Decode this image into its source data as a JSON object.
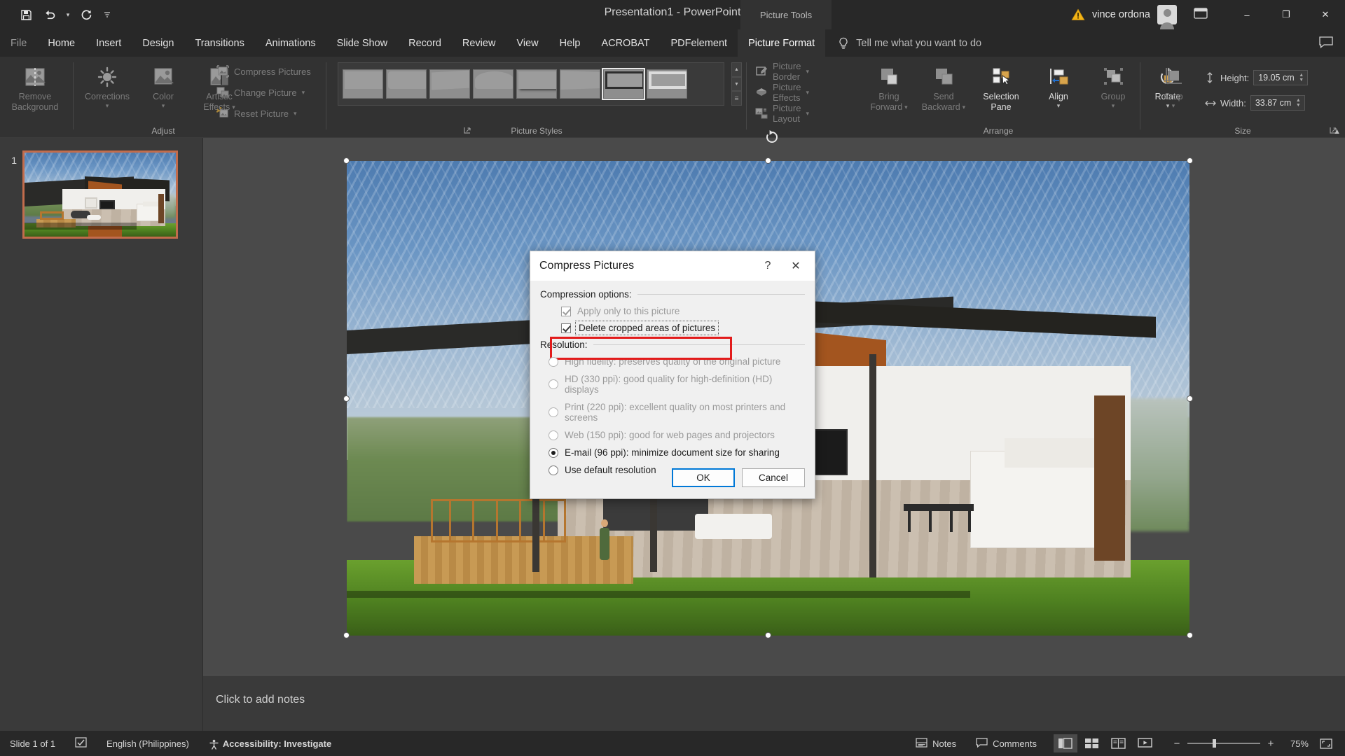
{
  "window": {
    "title": "Presentation1  -  PowerPoint",
    "contextual_tab_group": "Picture Tools",
    "account_name": "vince ordona",
    "icons": {
      "save": "save-icon",
      "undo": "undo-icon",
      "redo": "redo-icon",
      "qat_more": "qat-more-icon",
      "warning": "warning-icon",
      "avatar": "avatar-icon",
      "ribbon_display_options": "ribbon-display-options-icon",
      "minimize": "minimize-icon",
      "restore": "restore-icon",
      "close": "close-icon"
    },
    "controls": {
      "minimize": "–",
      "restore": "❐",
      "close": "✕"
    }
  },
  "tabs": [
    {
      "label": "File",
      "state": "dim"
    },
    {
      "label": "Home",
      "state": "normal"
    },
    {
      "label": "Insert",
      "state": "normal"
    },
    {
      "label": "Design",
      "state": "normal"
    },
    {
      "label": "Transitions",
      "state": "normal"
    },
    {
      "label": "Animations",
      "state": "normal"
    },
    {
      "label": "Slide Show",
      "state": "normal"
    },
    {
      "label": "Record",
      "state": "normal"
    },
    {
      "label": "Review",
      "state": "normal"
    },
    {
      "label": "View",
      "state": "normal"
    },
    {
      "label": "Help",
      "state": "normal"
    },
    {
      "label": "ACROBAT",
      "state": "normal"
    },
    {
      "label": "PDFelement",
      "state": "normal"
    },
    {
      "label": "Picture Format",
      "state": "active"
    }
  ],
  "tellme": {
    "placeholder": "Tell me what you want to do",
    "icon": "lightbulb-icon"
  },
  "ribbon": {
    "groups": [
      {
        "name": "Adjust",
        "label": "Adjust"
      },
      {
        "name": "PictureStyles",
        "label": "Picture Styles"
      },
      {
        "name": "Arrange",
        "label": "Arrange"
      },
      {
        "name": "Size",
        "label": "Size"
      }
    ],
    "adjust": {
      "remove_background": "Remove\nBackground",
      "remove_background_l1": "Remove",
      "remove_background_l2": "Background",
      "corrections": "Corrections",
      "color": "Color",
      "artistic_effects_l1": "Artistic",
      "artistic_effects_l2": "Effects",
      "compress_pictures": "Compress Pictures",
      "change_picture": "Change Picture",
      "reset_picture": "Reset Picture"
    },
    "picture_styles": {
      "picture_border": "Picture Border",
      "picture_effects": "Picture Effects",
      "picture_layout": "Picture Layout",
      "gallery_count": 8,
      "selected_index": 6
    },
    "arrange": {
      "bring_forward_l1": "Bring",
      "bring_forward_l2": "Forward",
      "send_backward_l1": "Send",
      "send_backward_l2": "Backward",
      "selection_pane_l1": "Selection",
      "selection_pane_l2": "Pane",
      "align": "Align",
      "group": "Group",
      "rotate": "Rotate"
    },
    "size": {
      "crop": "Crop",
      "height_label": "Height:",
      "height_value": "19.05 cm",
      "width_label": "Width:",
      "width_value": "33.87 cm"
    }
  },
  "slides": {
    "thumbnails": [
      {
        "number": "1"
      }
    ]
  },
  "notes": {
    "placeholder": "Click to add notes"
  },
  "dialog": {
    "title": "Compress Pictures",
    "help": "?",
    "close": "✕",
    "compression_section": "Compression options:",
    "checkboxes": [
      {
        "label": "Apply only to this picture",
        "accel": "A",
        "checked": true,
        "disabled": true,
        "highlighted": false
      },
      {
        "label": "Delete cropped areas of pictures",
        "accel": "D",
        "checked": true,
        "disabled": false,
        "highlighted": true
      }
    ],
    "resolution_section": "Resolution:",
    "resolutions": [
      {
        "label": "High fidelity: preserves quality of the original picture",
        "selected": false,
        "disabled": true
      },
      {
        "label": "HD (330 ppi): good quality for high-definition (HD) displays",
        "selected": false,
        "disabled": true
      },
      {
        "label": "Print (220 ppi): excellent quality on most printers and screens",
        "selected": false,
        "disabled": true
      },
      {
        "label": "Web (150 ppi): good for web pages and projectors",
        "selected": false,
        "disabled": true
      },
      {
        "label": "E-mail (96 ppi): minimize document size for sharing",
        "selected": true,
        "disabled": false
      },
      {
        "label": "Use default resolution",
        "selected": false,
        "disabled": false
      }
    ],
    "ok_label": "OK",
    "cancel_label": "Cancel",
    "highlight_color": "#e21b1b"
  },
  "statusbar": {
    "slide_indicator": "Slide 1 of 1",
    "language": "English (Philippines)",
    "accessibility": "Accessibility: Investigate",
    "notes_label": "Notes",
    "comments_label": "Comments",
    "zoom_percent": "75%",
    "zoom_out": "−",
    "zoom_in": "+",
    "icons": {
      "notes_check": "notes-check-icon",
      "accessibility": "accessibility-icon",
      "notes": "notes-icon",
      "comments": "comments-icon",
      "normal_view": "normal-view-icon",
      "slide_sorter": "slide-sorter-icon",
      "reading_view": "reading-view-icon",
      "slideshow": "slideshow-icon",
      "fit_slide": "fit-slide-icon"
    }
  },
  "colors": {
    "chrome": "#282828",
    "ribbon": "#323232",
    "accent_red": "#e21b1b",
    "accent_blue": "#0078d7",
    "thumb_border": "#c26c4c"
  }
}
